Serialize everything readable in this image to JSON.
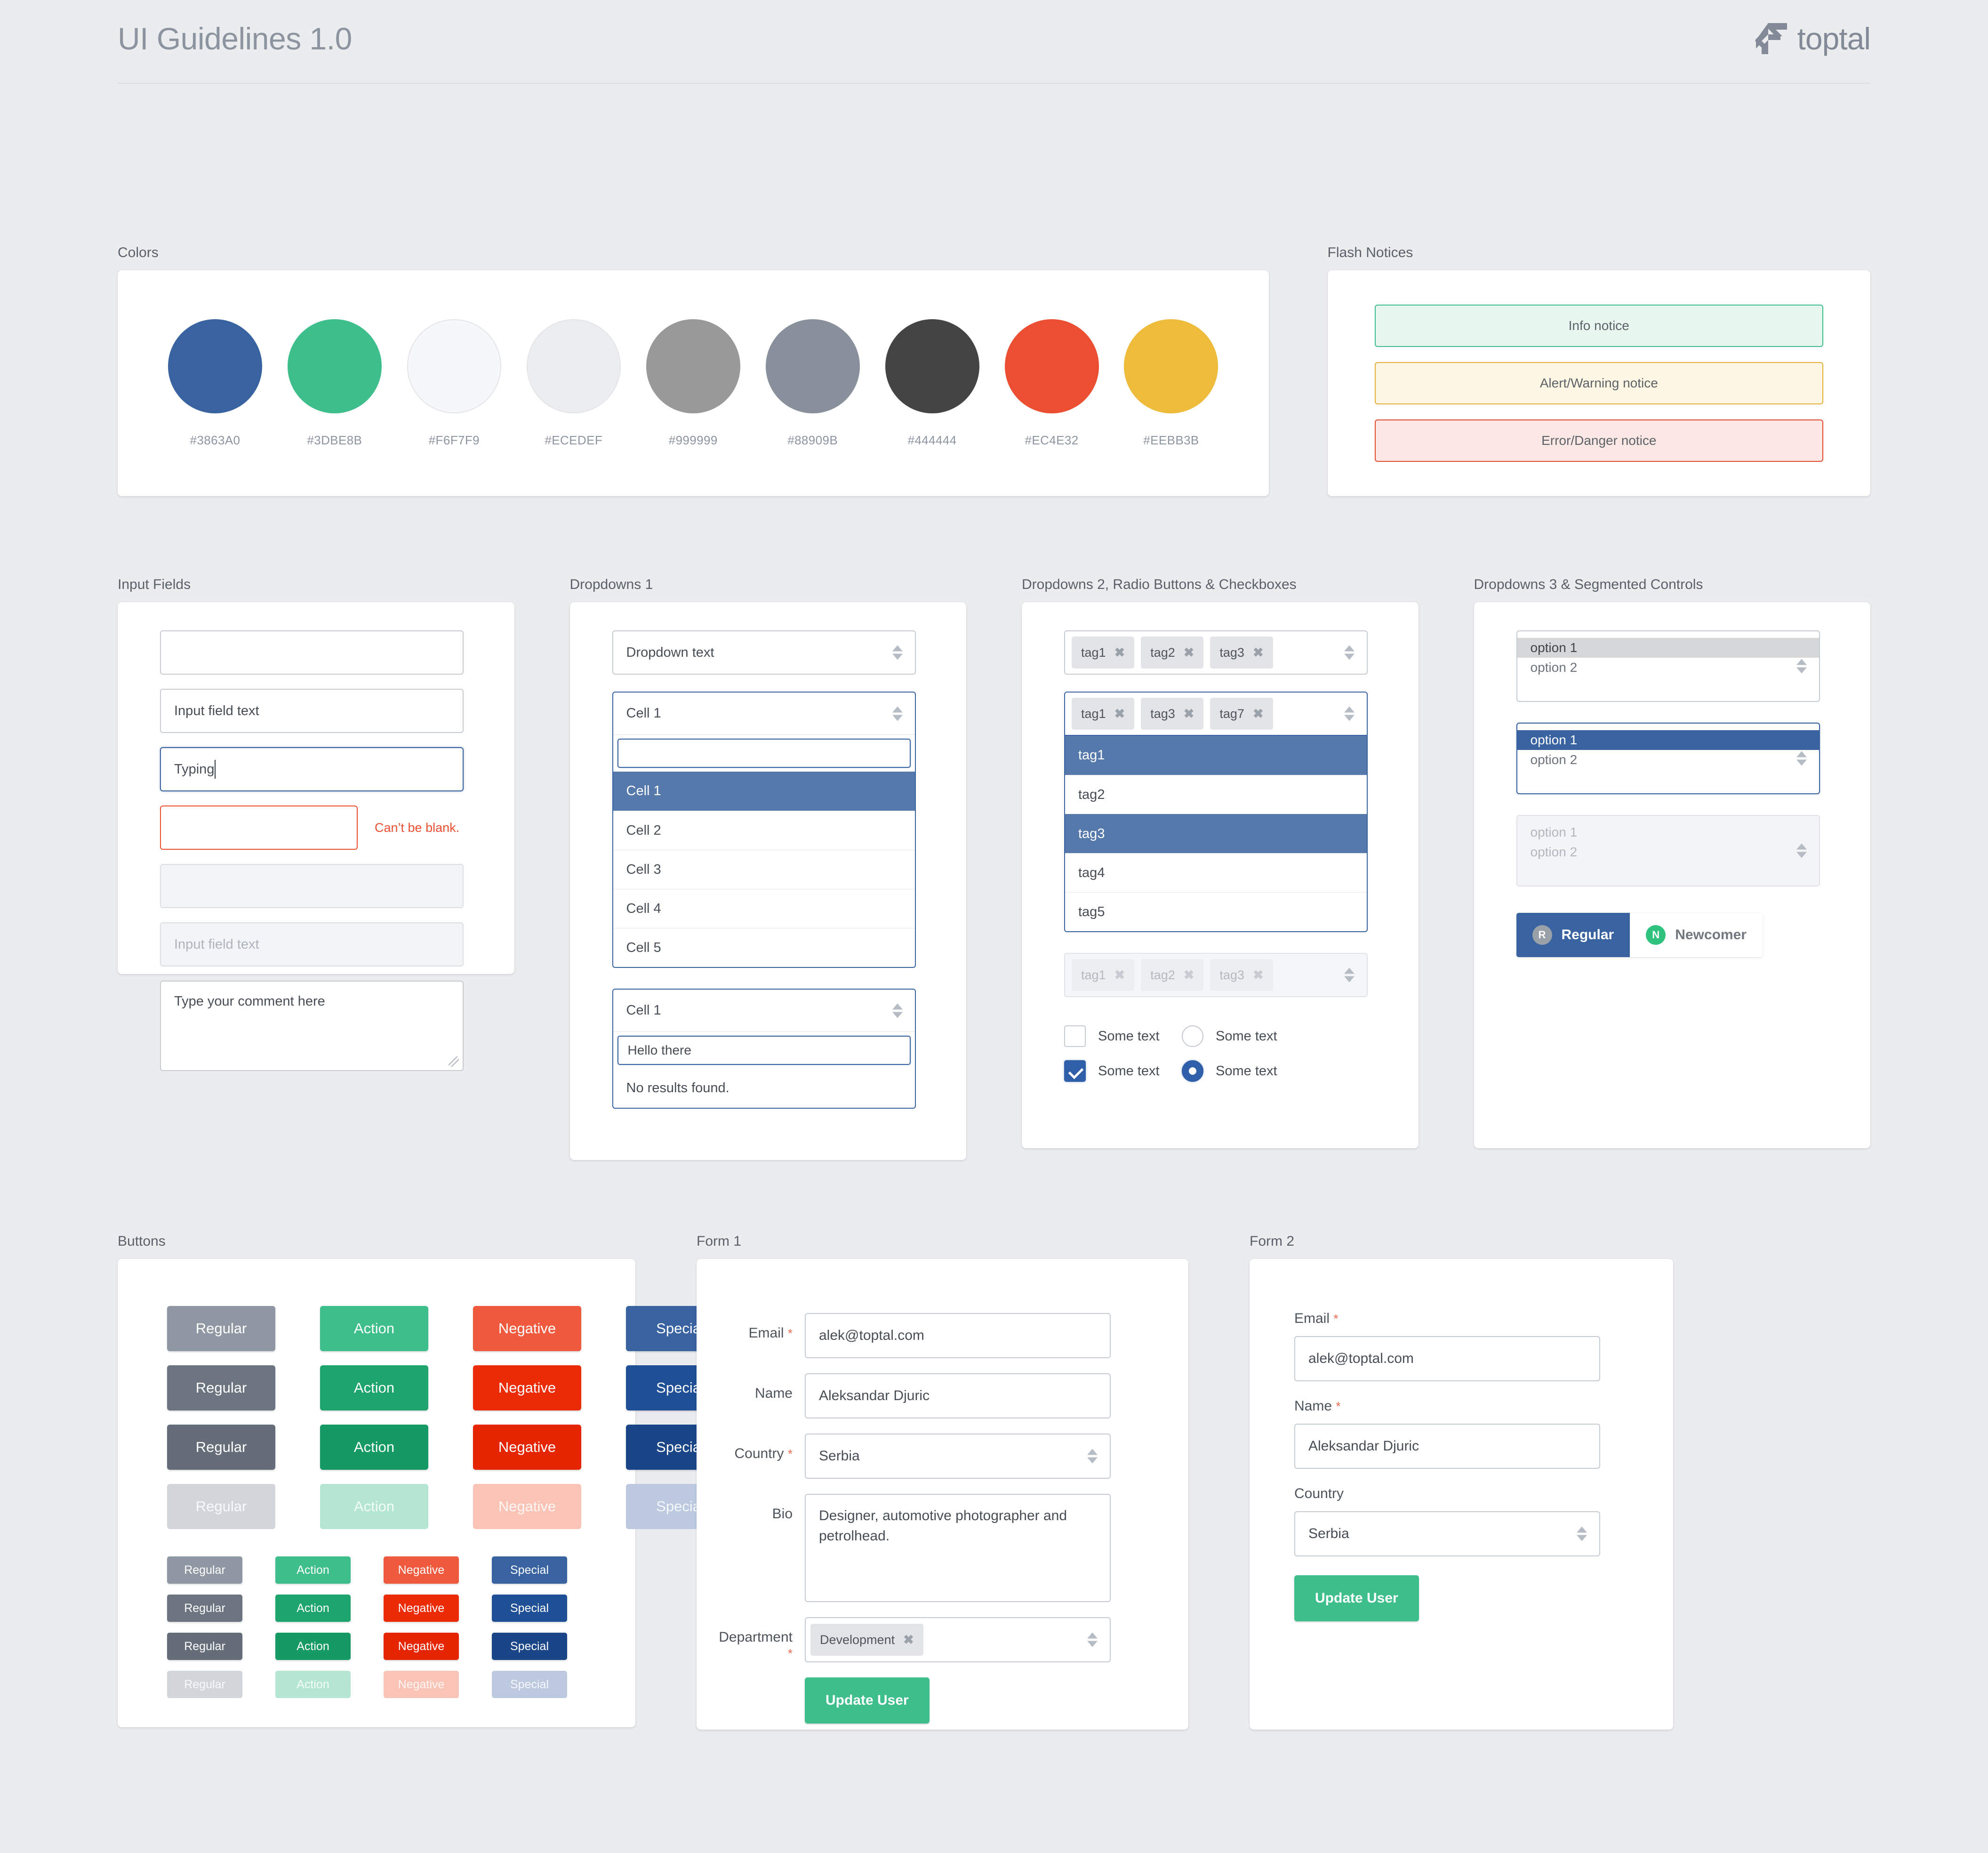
{
  "header": {
    "title": "UI Guidelines 1.0",
    "logo_word": "toptal"
  },
  "sections": {
    "colors": "Colors",
    "flash": "Flash Notices",
    "inputs": "Input Fields",
    "dropdowns1": "Dropdowns 1",
    "dropdowns2": "Dropdowns 2, Radio Buttons & Checkboxes",
    "dropdowns3": "Dropdowns 3 & Segmented Controls",
    "buttons": "Buttons",
    "form1": "Form 1",
    "form2": "Form 2"
  },
  "colors": [
    {
      "hex": "#3863A0",
      "label": "#3863A0"
    },
    {
      "hex": "#3DBE8B",
      "label": "#3DBE8B"
    },
    {
      "hex": "#F6F7F9",
      "label": "#F6F7F9"
    },
    {
      "hex": "#ECEDEF",
      "label": "#ECEDEF"
    },
    {
      "hex": "#999999",
      "label": "#999999"
    },
    {
      "hex": "#88909B",
      "label": "#88909B"
    },
    {
      "hex": "#444444",
      "label": "#444444"
    },
    {
      "hex": "#EC4E32",
      "label": "#EC4E32"
    },
    {
      "hex": "#EEBB3B",
      "label": "#EEBB3B"
    }
  ],
  "flash_notices": [
    {
      "text": "Info notice",
      "kind": "info"
    },
    {
      "text": "Alert/Warning notice",
      "kind": "warning"
    },
    {
      "text": "Error/Danger notice",
      "kind": "error"
    }
  ],
  "input_fields": {
    "empty_value": "",
    "filled_value": "Input field text",
    "typing_value": "Typing",
    "error_value": "",
    "error_message": "Can’t be blank.",
    "disabled_value": "",
    "disabled_placeholder": "Input field text",
    "textarea_value": "Type your comment here"
  },
  "dropdowns1": {
    "plain": "Dropdown text",
    "open1": {
      "head": "Cell 1",
      "search_value": "",
      "items": [
        "Cell 1",
        "Cell 2",
        "Cell 3",
        "Cell 4",
        "Cell 5"
      ],
      "selected": "Cell 1"
    },
    "open2": {
      "head": "Cell 1",
      "search_value": "Hello there",
      "empty_message": "No results found."
    }
  },
  "dropdowns2": {
    "tagsel_normal": [
      "tag1",
      "tag2",
      "tag3"
    ],
    "tagsel_open": {
      "tags": [
        "tag1",
        "tag3",
        "tag7"
      ],
      "items": [
        "tag1",
        "tag2",
        "tag3",
        "tag4",
        "tag5"
      ],
      "selected": [
        "tag1",
        "tag3"
      ]
    },
    "tagsel_disabled": [
      "tag1",
      "tag2",
      "tag3"
    ],
    "checkbox_unchecked_label": "Some text",
    "checkbox_checked_label": "Some text",
    "radio_unselected_label": "Some text",
    "radio_selected_label": "Some text",
    "remove_glyph": "✖"
  },
  "dropdowns3": {
    "listbox_normal": {
      "options": [
        "option 1",
        "option 2"
      ],
      "highlight": "option 1"
    },
    "listbox_focus": {
      "options": [
        "option 1",
        "option 2"
      ],
      "highlight": "option 1"
    },
    "listbox_disabled": {
      "options": [
        "option 1",
        "option 2"
      ]
    },
    "segmented": [
      {
        "label": "Regular",
        "badge": "R",
        "active": true
      },
      {
        "label": "Newcomer",
        "badge": "N",
        "active": false
      }
    ]
  },
  "buttons": {
    "labels": [
      "Regular",
      "Action",
      "Negative",
      "Special"
    ],
    "rows": [
      {
        "state": "normal",
        "colors": [
          "#8f97a2",
          "#3dbe8b",
          "#ef5a3f",
          "#3863a0"
        ],
        "text": "#ffffff"
      },
      {
        "state": "hover",
        "colors": [
          "#6c7480",
          "#1ea46d",
          "#eb2a06",
          "#1f4f94"
        ],
        "text": "#ffffff"
      },
      {
        "state": "active",
        "colors": [
          "#656d79",
          "#159a63",
          "#e42500",
          "#1a4687"
        ],
        "text": "#ffffff"
      },
      {
        "state": "disabled",
        "colors": [
          "#d2d5da",
          "#b4e6d2",
          "#f9c3b6",
          "#bcc9de"
        ],
        "text": "#ffffff"
      }
    ]
  },
  "form1": {
    "fields": [
      {
        "label": "Email",
        "required": true,
        "value": "alek@toptal.com",
        "type": "text"
      },
      {
        "label": "Name",
        "required": false,
        "value": "Aleksandar Djuric",
        "type": "text"
      },
      {
        "label": "Country",
        "required": true,
        "value": "Serbia",
        "type": "select"
      },
      {
        "label": "Bio",
        "required": false,
        "value": "Designer, automotive photographer and petrolhead.",
        "type": "textarea"
      },
      {
        "label": "Department",
        "required": true,
        "value": "Development",
        "type": "tagselect"
      }
    ],
    "submit_label": "Update User"
  },
  "form2": {
    "fields": [
      {
        "label": "Email",
        "required": true,
        "value": "alek@toptal.com",
        "type": "text"
      },
      {
        "label": "Name",
        "required": true,
        "value": "Aleksandar Djuric",
        "type": "text"
      },
      {
        "label": "Country",
        "required": false,
        "value": "Serbia",
        "type": "select"
      }
    ],
    "submit_label": "Update User"
  }
}
